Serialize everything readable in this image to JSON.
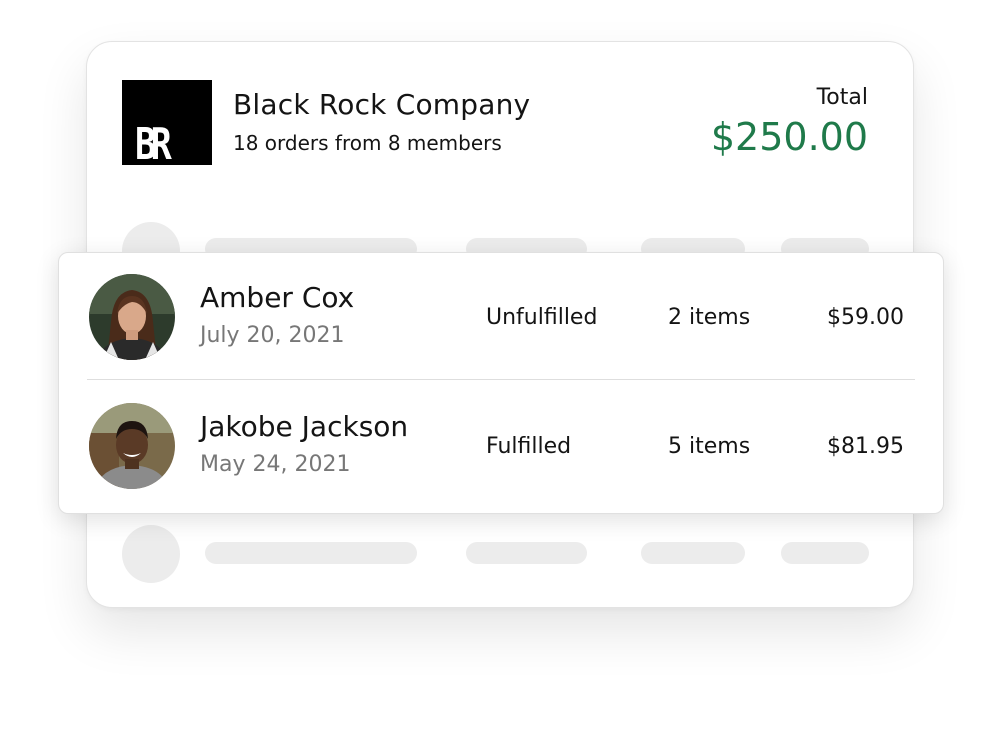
{
  "company": {
    "logo_text": "BR",
    "name": "Black Rock Company",
    "subtitle": "18 orders from 8 members",
    "total_label": "Total",
    "total_amount": "$250.00",
    "accent_color": "#1f7a4a"
  },
  "orders": [
    {
      "member": "Amber Cox",
      "date": "July 20, 2021",
      "status": "Unfulfilled",
      "items": "2 items",
      "price": "$59.00"
    },
    {
      "member": "Jakobe Jackson",
      "date": "May 24, 2021",
      "status": "Fulfilled",
      "items": "5 items",
      "price": "$81.95"
    }
  ]
}
